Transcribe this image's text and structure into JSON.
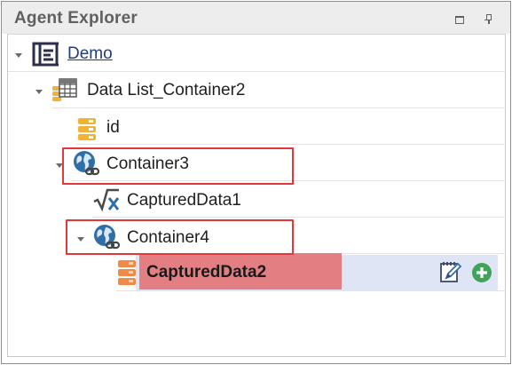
{
  "panel": {
    "title": "Agent Explorer",
    "restore_icon": "restore-window-icon",
    "pin_icon": "pin-icon"
  },
  "tree": {
    "root": {
      "label": "Demo",
      "icon": "agent-logo-icon",
      "expanded": true
    },
    "list": {
      "label": "Data List_Container2",
      "icon": "data-list-icon",
      "expanded": true
    },
    "id_item": {
      "label": "id",
      "icon": "field-icon"
    },
    "container3": {
      "label": "Container3",
      "icon": "globe-link-icon",
      "expanded": true
    },
    "captured1": {
      "label": "CapturedData1",
      "icon": "formula-icon"
    },
    "container4": {
      "label": "Container4",
      "icon": "globe-link-icon",
      "expanded": true
    },
    "captured2": {
      "label": "CapturedData2",
      "icon": "field-icon",
      "selected": true
    },
    "actions": {
      "edit_icon": "edit-icon",
      "add_icon": "add-circle-icon"
    }
  },
  "colors": {
    "highlight_box": "#e2383a",
    "selected_row": "#dfe5f5",
    "selected_label_bg": "#e37f82",
    "field_icon": "#f2b233",
    "globe_icon": "#2f6fa8",
    "add_icon": "#3fa35a"
  }
}
